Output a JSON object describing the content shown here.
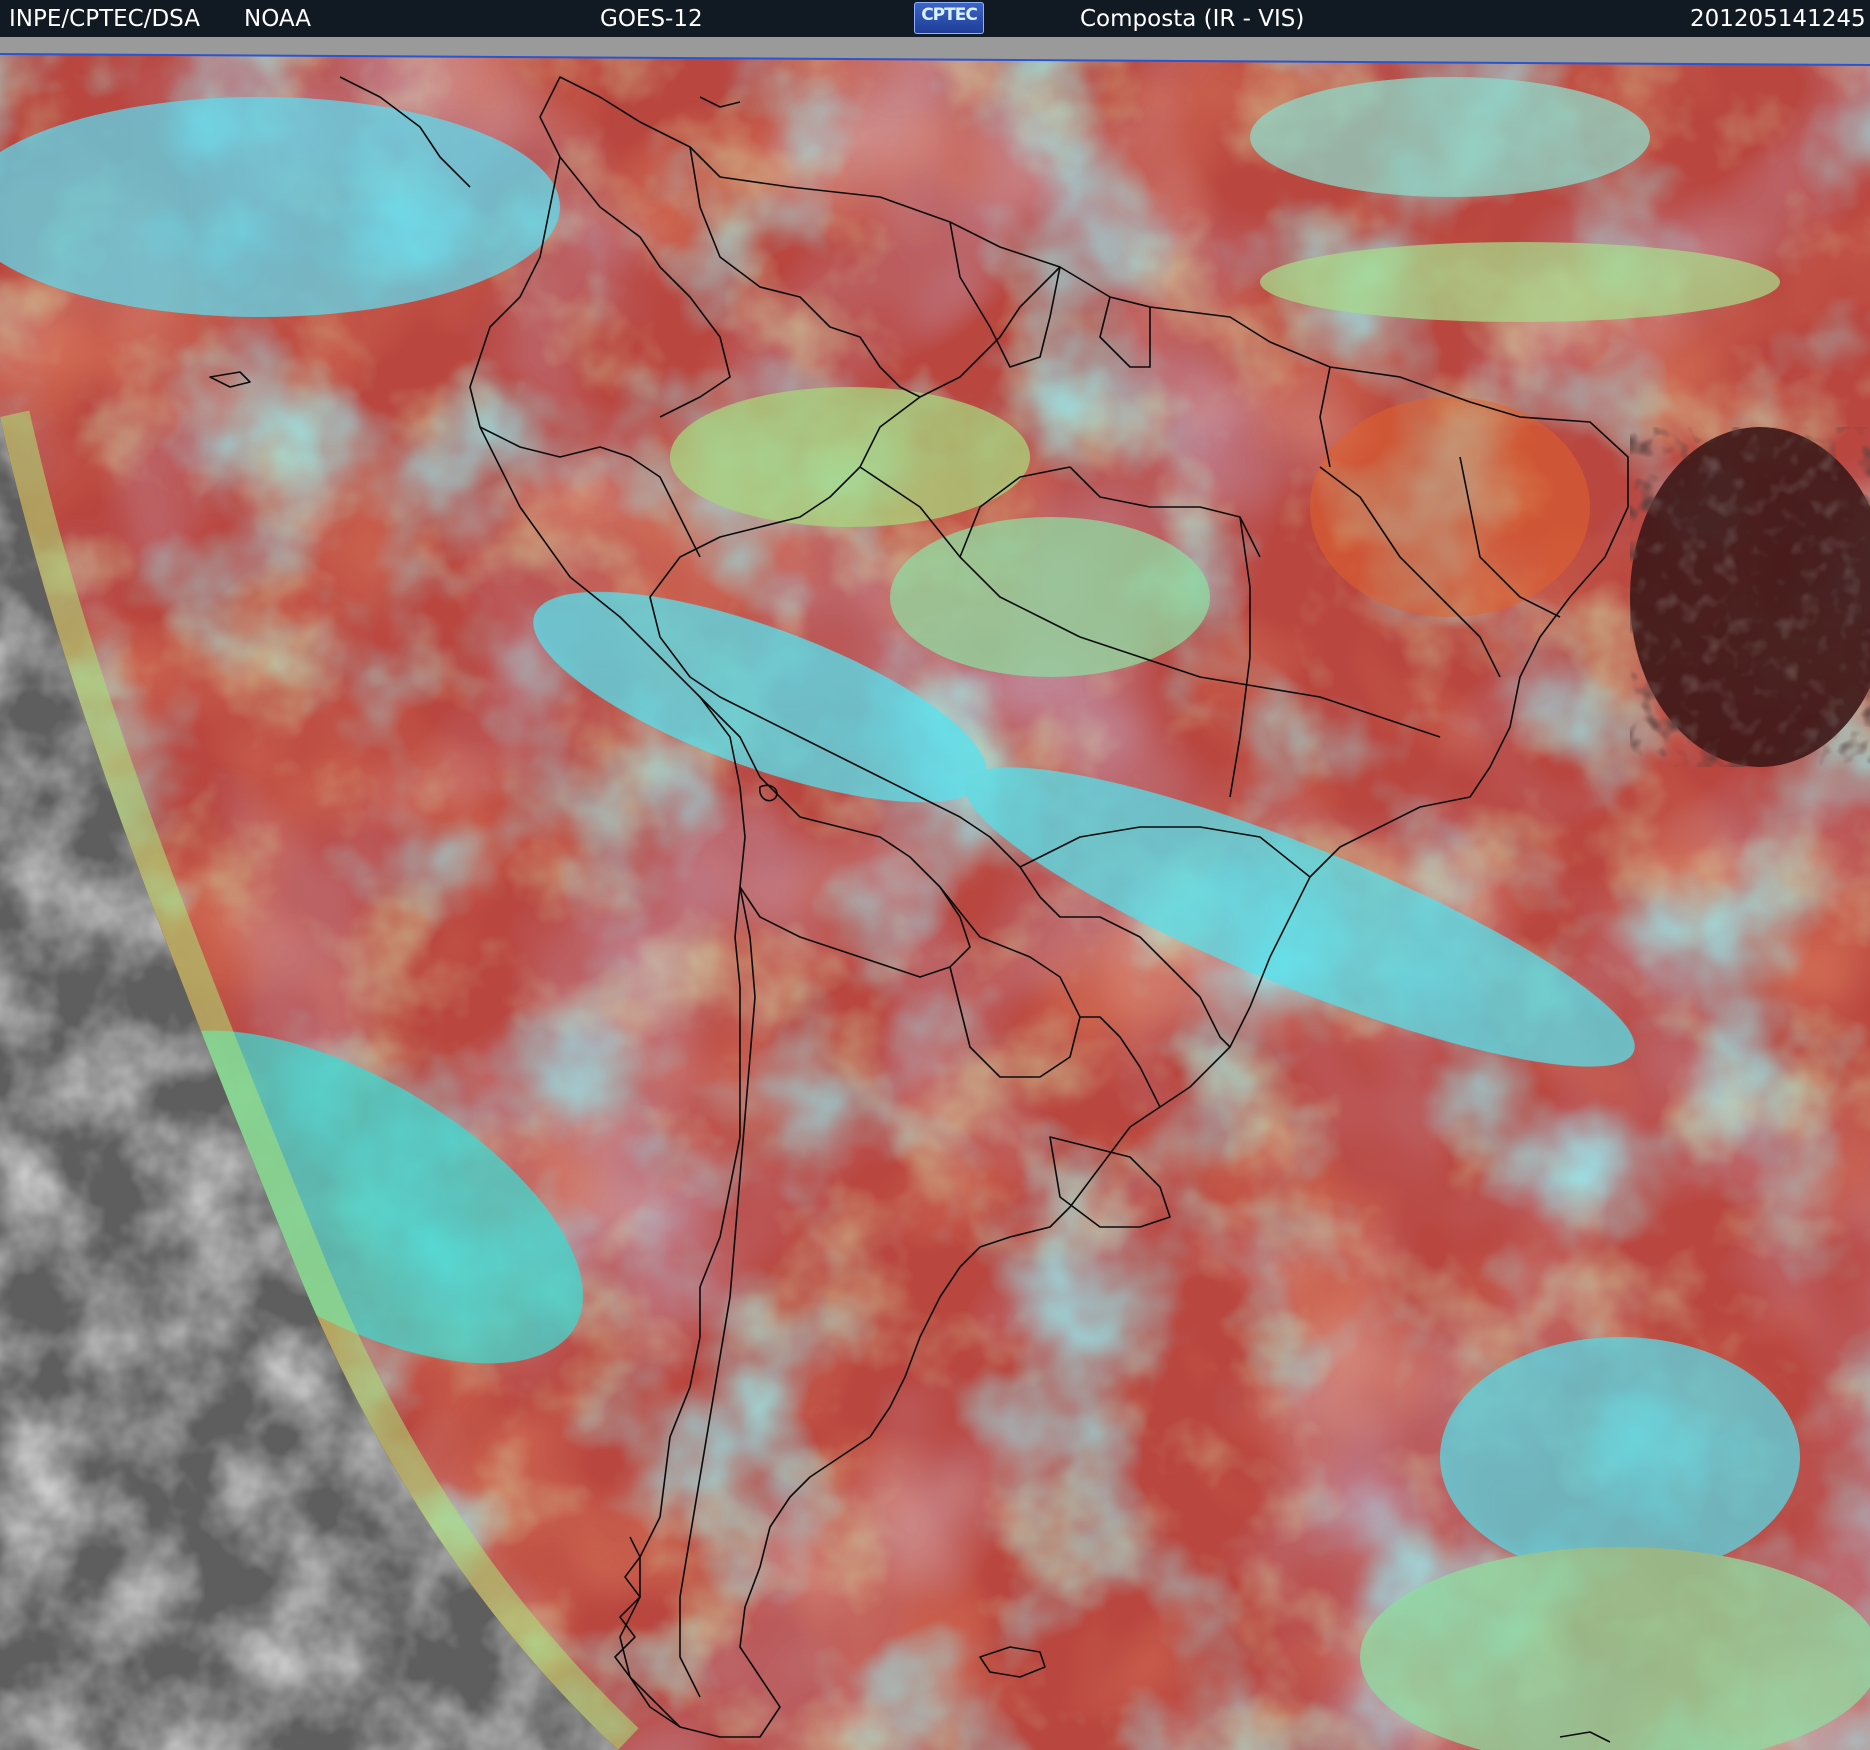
{
  "header": {
    "agency": "INPE/CPTEC/DSA",
    "source": "NOAA",
    "satellite": "GOES-12",
    "logo_text": "CPTEC",
    "product": "Composta (IR - VIS)",
    "timestamp": "201205141245"
  },
  "colors": {
    "header_bg": "#111922",
    "ocean_warm": "#b9463f",
    "cloud_cyan": "#49e3f0",
    "cloud_green": "#9fe07a",
    "space_gray": "#6d6d6d",
    "coast_line": "#0b0b0b"
  }
}
